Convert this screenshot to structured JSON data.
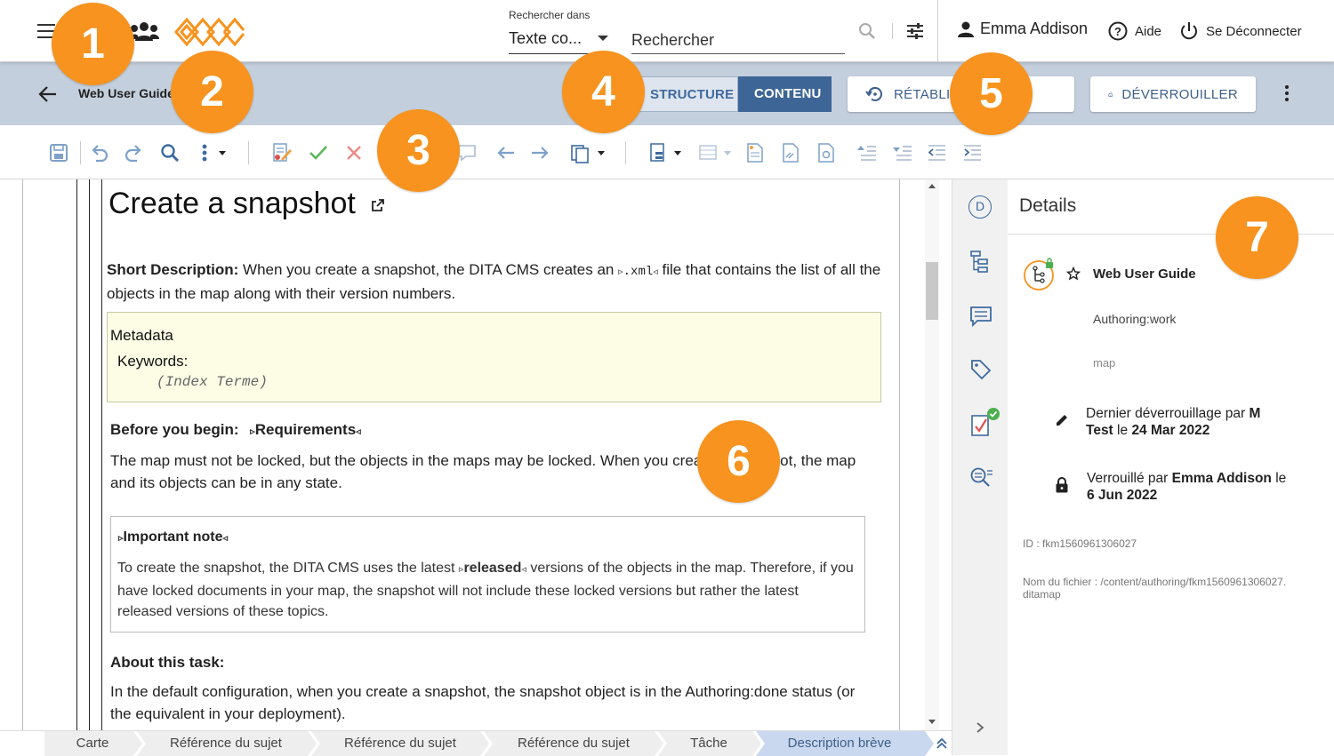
{
  "topbar": {
    "search_label": "Rechercher dans",
    "search_scope": "Texte co...",
    "search_placeholder": "Rechercher",
    "user_name": "Emma Addison",
    "help_label": "Aide",
    "logout_label": "Se Déconnecter"
  },
  "docbar": {
    "title": "Web User Guide",
    "structure_label": "STRUCTURE",
    "content_label": "CONTENU",
    "restore_label": "RÉTABLIR LA REVUE",
    "unlock_label": "DÉVERROUILLER"
  },
  "editor": {
    "heading": "Create a snapshot",
    "shortdesc_label": "Short Description:",
    "shortdesc_text_1": "When you create a snapshot, the DITA CMS creates an",
    "shortdesc_code": ".xml",
    "shortdesc_text_2": "file that contains the list of all the objects in the map along with their version numbers.",
    "metadata_label": "Metadata",
    "keywords_label": "Keywords:",
    "index_term": "(Index Terme)",
    "prereq_label": "Before you begin:",
    "requirements_label": "Requirements",
    "prereq_text": "The map must not be locked, but the objects in the maps may be locked. When you create a snapshot, the map and its objects can be in any state.",
    "note_title": "Important note",
    "note_text_1": "To create the snapshot, the DITA CMS uses the latest",
    "note_bold": "released",
    "note_text_2": "versions of the objects in the map. Therefore, if you have locked documents in your map, the snapshot will not include these locked versions but rather the latest released versions of these topics.",
    "about_label": "About this task:",
    "about_text": "In the default configuration, when you create a snapshot, the snapshot object is in the Authoring:done status (or the equivalent in your deployment)."
  },
  "breadcrumbs": [
    "Carte",
    "Référence du sujet",
    "Référence du sujet",
    "Référence du sujet",
    "Tâche",
    "Description brève"
  ],
  "details": {
    "title": "Details",
    "rail_avatar": "D",
    "doc_name": "Web User Guide",
    "status": "Authoring:work",
    "type": "map",
    "last_unlock_prefix": "Dernier déverrouillage par",
    "last_unlock_user_1": "M",
    "last_unlock_user_2": "Test",
    "last_unlock_le": "le",
    "last_unlock_date": "24 Mar 2022",
    "locked_prefix": "Verrouillé par",
    "locked_user": "Emma Addison",
    "locked_le": "le",
    "locked_date": "6 Jun 2022",
    "id_label": "ID : fkm1560961306027",
    "filename_label": "Nom du fichier : /content/authoring/fkm1560961306027.",
    "filename_ext": "ditamap"
  },
  "callouts": [
    "1",
    "2",
    "3",
    "4",
    "5",
    "6",
    "7"
  ],
  "colors": {
    "accent_orange": "#f7931e",
    "docbar_bg": "#c4cfdd",
    "content_toggle": "#3d6596",
    "metadata_bg": "#fdfde6"
  }
}
